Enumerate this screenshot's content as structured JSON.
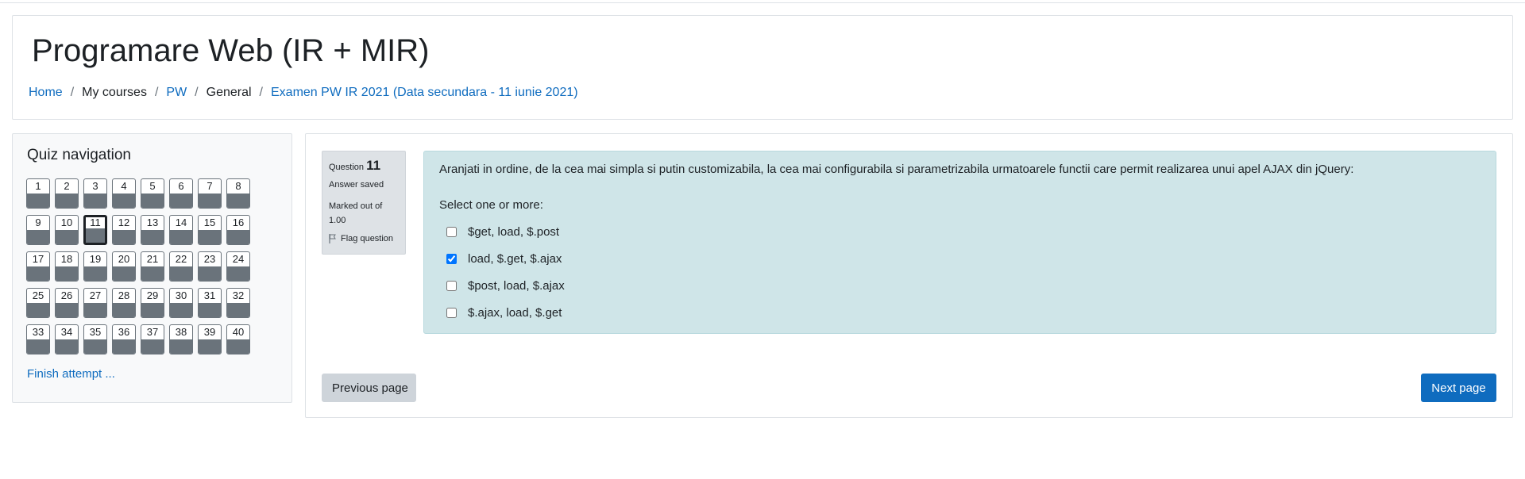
{
  "header": {
    "title": "Programare Web (IR + MIR)",
    "breadcrumb": [
      {
        "label": "Home",
        "link": true
      },
      {
        "label": "My courses",
        "link": false
      },
      {
        "label": "PW",
        "link": true
      },
      {
        "label": "General",
        "link": false
      },
      {
        "label": "Examen PW IR 2021 (Data secundara - 11 iunie 2021)",
        "link": true
      }
    ],
    "separator": "/"
  },
  "quiz_nav": {
    "title": "Quiz navigation",
    "questions": [
      "1",
      "2",
      "3",
      "4",
      "5",
      "6",
      "7",
      "8",
      "9",
      "10",
      "11",
      "12",
      "13",
      "14",
      "15",
      "16",
      "17",
      "18",
      "19",
      "20",
      "21",
      "22",
      "23",
      "24",
      "25",
      "26",
      "27",
      "28",
      "29",
      "30",
      "31",
      "32",
      "33",
      "34",
      "35",
      "36",
      "37",
      "38",
      "39",
      "40"
    ],
    "current": "11",
    "finish_label": "Finish attempt ..."
  },
  "question": {
    "label": "Question",
    "number": "11",
    "state": "Answer saved",
    "grade_line1": "Marked out of",
    "grade_line2": "1.00",
    "flag_label": "Flag question",
    "text": "Aranjati in ordine, de la cea mai simpla si putin customizabila, la cea mai configurabila si parametrizabila urmatoarele functii care permit realizarea unui apel AJAX din jQuery:",
    "prompt": "Select one or more:",
    "answers": [
      {
        "label": "$get, load, $.post",
        "checked": false
      },
      {
        "label": "load, $.get, $.ajax",
        "checked": true
      },
      {
        "label": "$post, load, $.ajax",
        "checked": false
      },
      {
        "label": "$.ajax, load, $.get",
        "checked": false
      }
    ]
  },
  "buttons": {
    "previous": "Previous page",
    "next": "Next page"
  },
  "colors": {
    "link": "#0f6cbf",
    "formulation_bg": "#cfe5e8",
    "info_bg": "#dee2e6",
    "nav_fill": "#6a737b",
    "primary": "#0f6cbf"
  }
}
